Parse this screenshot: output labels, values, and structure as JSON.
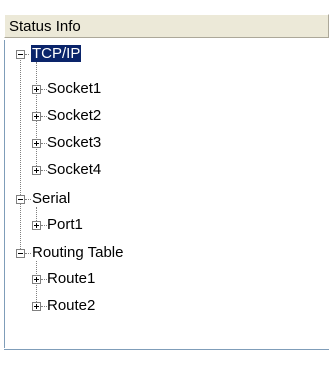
{
  "header": {
    "title": "Status Info"
  },
  "tree": {
    "nodes": [
      {
        "label": "TCP/IP",
        "state": "expanded",
        "selected": true,
        "children": [
          {
            "label": "Socket1",
            "state": "collapsed"
          },
          {
            "label": "Socket2",
            "state": "collapsed"
          },
          {
            "label": "Socket3",
            "state": "collapsed"
          },
          {
            "label": "Socket4",
            "state": "collapsed"
          }
        ]
      },
      {
        "label": "Serial",
        "state": "expanded",
        "selected": false,
        "children": [
          {
            "label": "Port1",
            "state": "collapsed"
          }
        ]
      },
      {
        "label": "Routing Table",
        "state": "expanded",
        "selected": false,
        "children": [
          {
            "label": "Route1",
            "state": "collapsed"
          },
          {
            "label": "Route2",
            "state": "collapsed"
          }
        ]
      }
    ]
  },
  "colors": {
    "header_background": "#ece9d8",
    "selection_background": "#0a246a",
    "selection_text": "#ffffff",
    "tree_line": "#808080",
    "border": "#7f9db9"
  },
  "icons": {
    "expanded": "minus-box-icon",
    "collapsed": "plus-box-icon"
  }
}
